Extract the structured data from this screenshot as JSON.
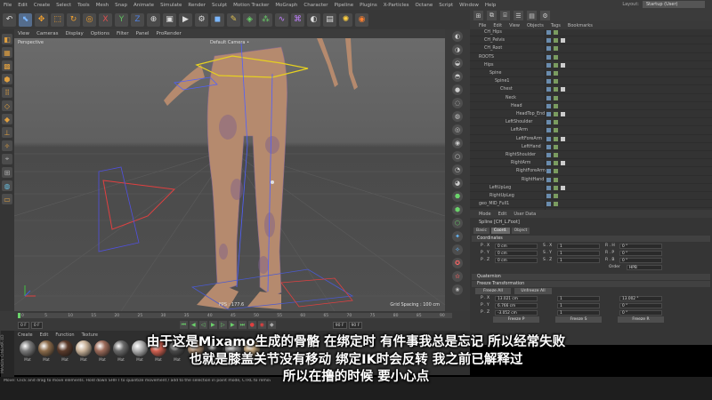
{
  "menubar": {
    "items": [
      "File",
      "Edit",
      "Create",
      "Select",
      "Tools",
      "Mesh",
      "Snap",
      "Animate",
      "Simulate",
      "Render",
      "Sculpt",
      "Motion Tracker",
      "MoGraph",
      "Character",
      "Pipeline",
      "Plugins",
      "X-Particles",
      "Octane",
      "Script",
      "Window",
      "Help"
    ],
    "layout_label": "Layout:",
    "layout_value": "Startup (User)"
  },
  "toolbar": {
    "icons": [
      "undo-icon",
      "select-icon",
      "move-icon",
      "scale-icon",
      "rotate-icon",
      "x-axis-icon",
      "y-axis-icon",
      "z-axis-icon",
      "coord-icon",
      "render-view-icon",
      "render-icon",
      "render-settings-icon",
      "cube-icon",
      "pen-icon",
      "subdivide-icon",
      "array-icon",
      "spline-icon",
      "deformer-icon",
      "scene-icon",
      "camera-icon",
      "light-icon"
    ]
  },
  "viewport": {
    "menu": [
      "View",
      "Cameras",
      "Display",
      "Options",
      "Filter",
      "Panel",
      "ProRender"
    ],
    "label": "Perspective",
    "camera": "Default Camera •",
    "fps": "FPS : 177.6",
    "grid": "Grid Spacing : 100 cm"
  },
  "objects": {
    "menu": [
      "File",
      "Edit",
      "View",
      "Objects",
      "Tags",
      "Bookmarks"
    ],
    "rows": [
      {
        "name": "CH_Hips",
        "indent": 1
      },
      {
        "name": "CH_Pelvis",
        "indent": 1
      },
      {
        "name": "CH_Root",
        "indent": 1
      },
      {
        "name": "ROOTS",
        "indent": 0
      },
      {
        "name": "Hips",
        "indent": 1
      },
      {
        "name": "Spine",
        "indent": 2
      },
      {
        "name": "Spine1",
        "indent": 3
      },
      {
        "name": "Chest",
        "indent": 4
      },
      {
        "name": "Neck",
        "indent": 5
      },
      {
        "name": "Head",
        "indent": 6
      },
      {
        "name": "HeadTop_End",
        "indent": 7
      },
      {
        "name": "LeftShoulder",
        "indent": 5
      },
      {
        "name": "LeftArm",
        "indent": 6
      },
      {
        "name": "LeftForeArm",
        "indent": 7
      },
      {
        "name": "LeftHand",
        "indent": 8
      },
      {
        "name": "RightShoulder",
        "indent": 5
      },
      {
        "name": "RightArm",
        "indent": 6
      },
      {
        "name": "RightForeArm",
        "indent": 7
      },
      {
        "name": "RightHand",
        "indent": 8
      },
      {
        "name": "LeftUpLeg",
        "indent": 2
      },
      {
        "name": "RightUpLeg",
        "indent": 2
      },
      {
        "name": "geo_MID_Full1",
        "indent": 0
      }
    ]
  },
  "attributes": {
    "menu": [
      "Mode",
      "Edit",
      "User Data"
    ],
    "object": "Spline [CH_L.Foot]",
    "tabs": [
      "Basic",
      "Coord.",
      "Object"
    ],
    "coordinates_title": "Coordinates",
    "coords": [
      {
        "axis": "P . X",
        "value": "0 cm",
        "s_axis": "S . X",
        "s_value": "1",
        "r_axis": "R . H",
        "r_value": "0 °"
      },
      {
        "axis": "P . Y",
        "value": "0 cm",
        "s_axis": "S . Y",
        "s_value": "1",
        "r_axis": "R . P",
        "r_value": "0 °"
      },
      {
        "axis": "P . Z",
        "value": "0 cm",
        "s_axis": "S . Z",
        "s_value": "1",
        "r_axis": "R . B",
        "r_value": "0 °"
      }
    ],
    "order_label": "Order",
    "order_value": "HPB",
    "quaternion_title": "Quaternion",
    "freeze_title": "Freeze Transformation",
    "freeze_all": "Freeze All",
    "unfreeze_all": "Unfreeze All",
    "freeze_rows": [
      {
        "axis": "P . X",
        "value": "13.021 cm",
        "s_value": "1",
        "r_value": "13.002 °"
      },
      {
        "axis": "P . Y",
        "value": "6.766 cm",
        "s_value": "1",
        "r_value": "0 °"
      },
      {
        "axis": "P . Z",
        "value": "-3.052 cm",
        "s_value": "1",
        "r_value": "0 °"
      }
    ],
    "freeze_buttons": [
      "Freeze P",
      "Freeze S",
      "Freeze R"
    ]
  },
  "timeline": {
    "ticks": [
      "0",
      "5",
      "10",
      "15",
      "20",
      "25",
      "30",
      "35",
      "40",
      "45",
      "50",
      "55",
      "60",
      "65",
      "70",
      "75",
      "80",
      "85",
      "90"
    ],
    "start": "0 F",
    "end": "90 F"
  },
  "materials": {
    "menu": [
      "Create",
      "Edit",
      "Function",
      "Texture"
    ],
    "items": [
      {
        "label": "Mat",
        "color": "#7a7a7a"
      },
      {
        "label": "Mat",
        "color": "#8b6b4a"
      },
      {
        "label": "Mat",
        "color": "#5a3a2a"
      },
      {
        "label": "Mat",
        "color": "#c9b39a"
      },
      {
        "label": "Mat",
        "color": "#9c6b5a"
      },
      {
        "label": "Mat",
        "color": "#6a6a6a"
      },
      {
        "label": "Mat",
        "color": "#b0b0b0"
      },
      {
        "label": "Mat",
        "color": "#d06050"
      },
      {
        "label": "Mat",
        "color": "#4a4a4a"
      },
      {
        "label": "Mat",
        "color": "#a88a70"
      },
      {
        "label": "Mat",
        "color": "#303030"
      },
      {
        "label": "Mat",
        "color": "#8c8c8c"
      },
      {
        "label": "Mat",
        "color": "#bba07a"
      }
    ]
  },
  "status": {
    "text": "Move: Click and drag to move elements. Hold down SHIFT to quantize movement / add to the selection in point mode, CTRL to remove."
  },
  "subtitles": {
    "line1": "由于这是Mixamo生成的骨骼 在绑定时 有件事我总是忘记 所以经常失败",
    "line2": "也就是膝盖关节没有移动 绑定IK时会反转 我之前已解释过",
    "line3": "所以在撸的时候 要小心点"
  },
  "colors": {
    "accent": "#546c8c",
    "selection_blue": "#3a6ea5"
  }
}
